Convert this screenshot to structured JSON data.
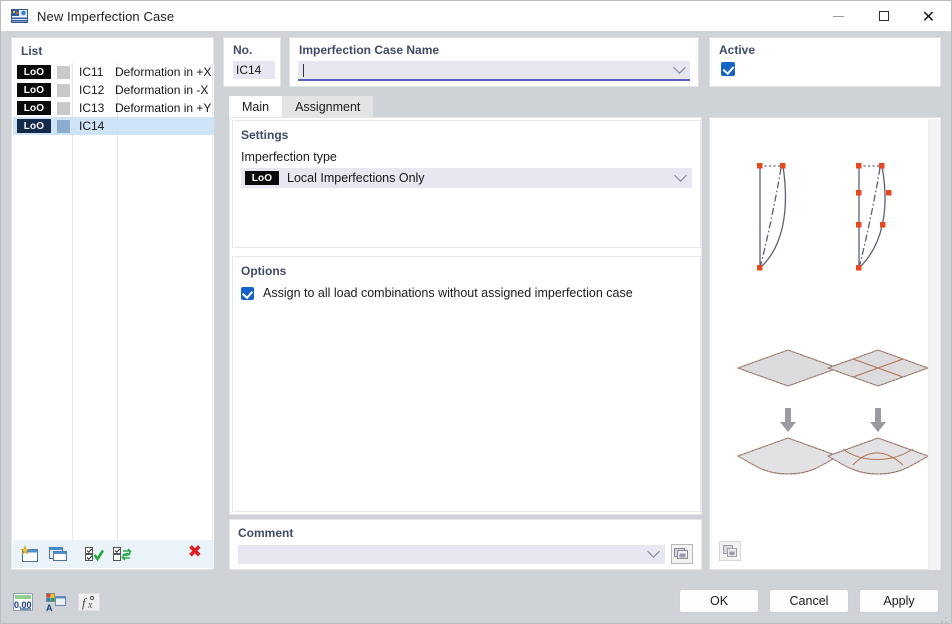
{
  "window": {
    "title": "New Imperfection Case",
    "icon": "app-window-icon",
    "minimize_label": "–",
    "maximize_label": "□",
    "close_label": "✕"
  },
  "list_panel": {
    "legend": "List",
    "rows": [
      {
        "badge": "LoO",
        "no": "IC11",
        "name": "Deformation in +X",
        "selected": false
      },
      {
        "badge": "LoO",
        "no": "IC12",
        "name": "Deformation in -X",
        "selected": false
      },
      {
        "badge": "LoO",
        "no": "IC13",
        "name": "Deformation in +Y",
        "selected": false
      },
      {
        "badge": "LoO",
        "no": "IC14",
        "name": "",
        "selected": true
      }
    ],
    "toolbar": {
      "new_case": "new-imperfection-case-icon",
      "copy_case": "copy-imperfection-case-icon",
      "select_all": "select-all-icon",
      "invert_selection": "invert-selection-icon",
      "delete": "✖"
    }
  },
  "no_field": {
    "label": "No.",
    "value": "IC14"
  },
  "name_field": {
    "label": "Imperfection Case Name",
    "value": "",
    "placeholder": ""
  },
  "active_field": {
    "label": "Active",
    "checked": true
  },
  "tabs": [
    {
      "label": "Main",
      "active": true
    },
    {
      "label": "Assignment",
      "active": false
    }
  ],
  "settings": {
    "title": "Settings",
    "imperfection_type_label": "Imperfection type",
    "imperfection_type_badge": "LoO",
    "imperfection_type_value": "Local Imperfections Only"
  },
  "options": {
    "title": "Options",
    "assign_all_label": "Assign to all load combinations without assigned imperfection case",
    "assign_all_checked": true
  },
  "comment": {
    "title": "Comment",
    "value": "",
    "button_icon": "comment-library-icon"
  },
  "illustration": {
    "button_icon": "image-options-icon"
  },
  "bottom_tools": [
    {
      "icon": "units-decimal-places-icon"
    },
    {
      "icon": "display-properties-icon"
    },
    {
      "icon": "formula-fx-icon"
    }
  ],
  "dialog_buttons": [
    {
      "label": "OK",
      "name": "ok-button"
    },
    {
      "label": "Cancel",
      "name": "cancel-button"
    },
    {
      "label": "Apply",
      "name": "apply-button"
    }
  ],
  "colors": {
    "accent_blue": "#1464c8",
    "selection_blue": "#cfe4f7",
    "legend_text": "#3f4a66",
    "field_fill": "#e6e7f0",
    "badge_black": "#0a0a0a",
    "delete_red": "#e02020",
    "underline_violet": "#5b5fbe",
    "dialog_bg": "#cfd2d6"
  }
}
